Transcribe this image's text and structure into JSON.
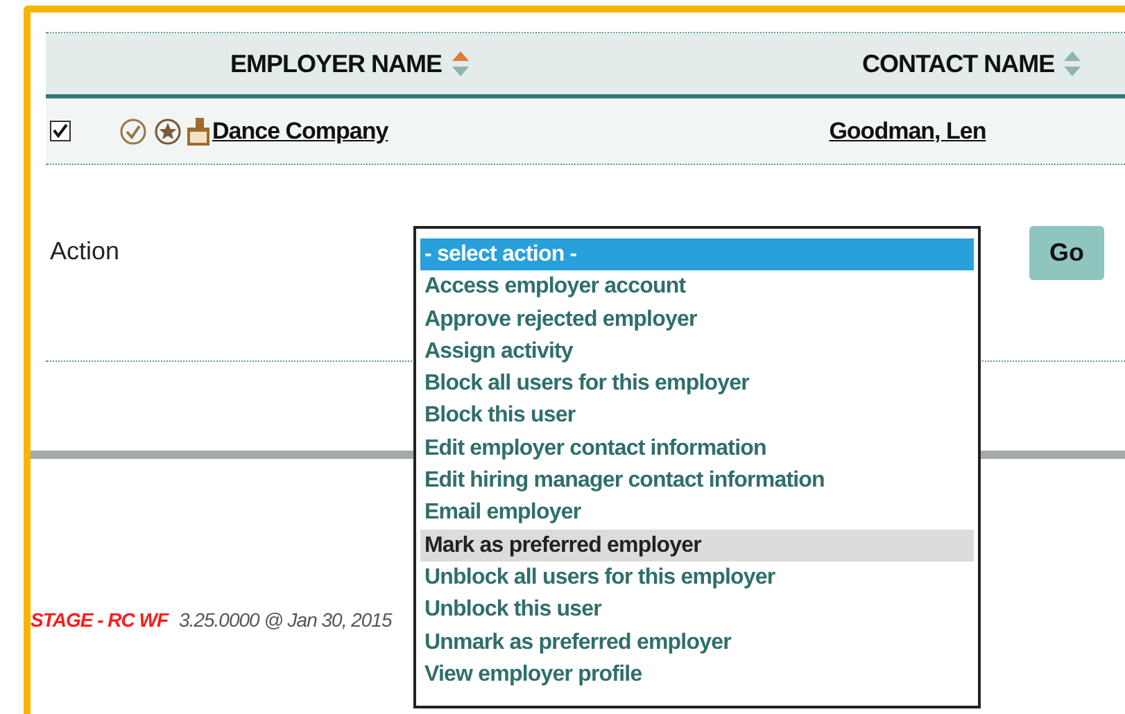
{
  "table": {
    "columns": [
      {
        "label": "EMPLOYER NAME",
        "sorted": true
      },
      {
        "label": "CONTACT NAME",
        "sorted": false
      }
    ],
    "rows": [
      {
        "checked": true,
        "employer": "Dance Company",
        "contact": "Goodman, Len"
      }
    ]
  },
  "action": {
    "label": "Action",
    "button": "Go",
    "options": [
      {
        "label": "- select action -",
        "selected": true,
        "highlighted": false
      },
      {
        "label": "Access employer account",
        "selected": false,
        "highlighted": false
      },
      {
        "label": "Approve rejected employer",
        "selected": false,
        "highlighted": false
      },
      {
        "label": "Assign activity",
        "selected": false,
        "highlighted": false
      },
      {
        "label": "Block all users for this employer",
        "selected": false,
        "highlighted": false
      },
      {
        "label": "Block this user",
        "selected": false,
        "highlighted": false
      },
      {
        "label": "Edit employer contact information",
        "selected": false,
        "highlighted": false
      },
      {
        "label": "Edit hiring manager contact information",
        "selected": false,
        "highlighted": false
      },
      {
        "label": "Email employer",
        "selected": false,
        "highlighted": false
      },
      {
        "label": "Mark as preferred employer",
        "selected": false,
        "highlighted": true
      },
      {
        "label": "Unblock all users for this employer",
        "selected": false,
        "highlighted": false
      },
      {
        "label": "Unblock this user",
        "selected": false,
        "highlighted": false
      },
      {
        "label": "Unmark as preferred employer",
        "selected": false,
        "highlighted": false
      },
      {
        "label": "View employer profile",
        "selected": false,
        "highlighted": false
      }
    ]
  },
  "footer": {
    "environment": "STAGE - RC WF",
    "version": "3.25.0000 @ Jan 30, 2015"
  }
}
